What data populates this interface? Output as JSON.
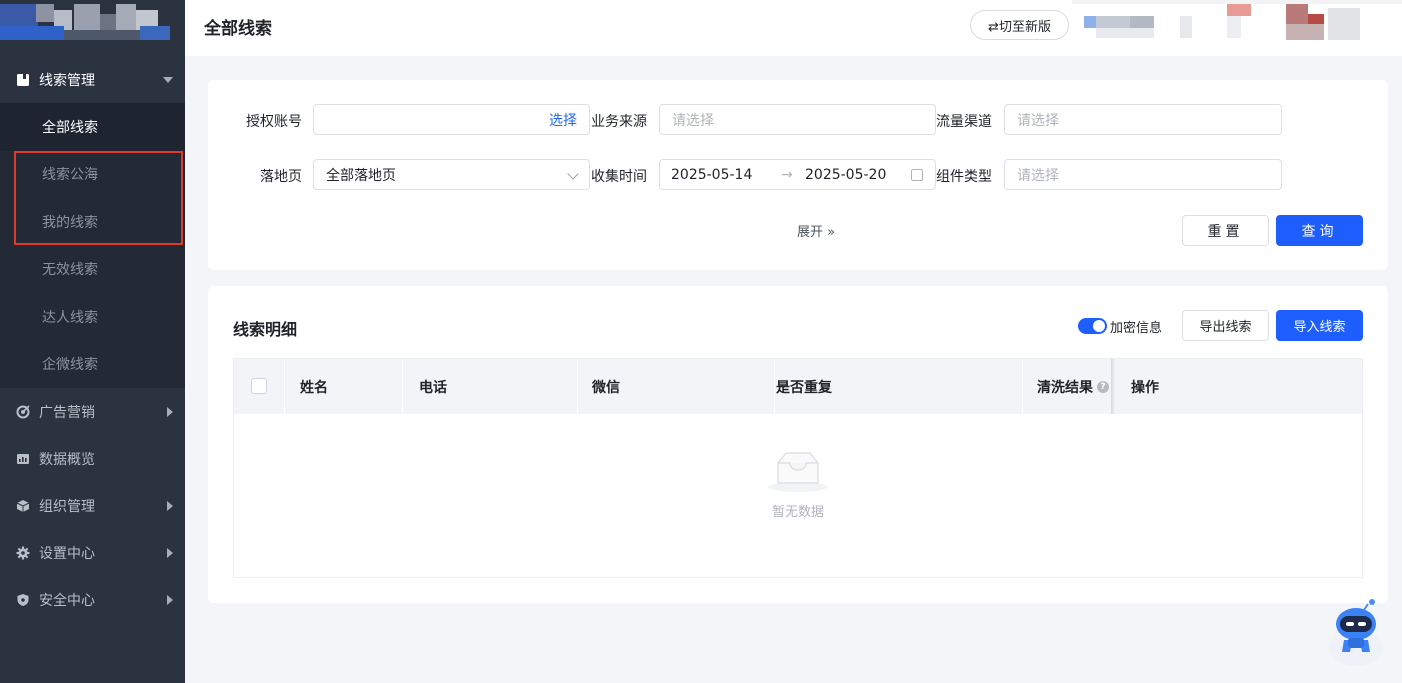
{
  "sidebar": {
    "groups": [
      {
        "label": "线索管理",
        "icon": "document-icon",
        "open": true,
        "items": [
          {
            "label": "全部线索",
            "active": true
          },
          {
            "label": "线索公海"
          },
          {
            "label": "我的线索"
          },
          {
            "label": "无效线索"
          },
          {
            "label": "达人线索"
          },
          {
            "label": "企微线索"
          }
        ]
      },
      {
        "label": "广告营销",
        "icon": "target-icon"
      },
      {
        "label": "数据概览",
        "icon": "chart-icon"
      },
      {
        "label": "组织管理",
        "icon": "cube-icon"
      },
      {
        "label": "设置中心",
        "icon": "gear-icon"
      },
      {
        "label": "安全中心",
        "icon": "shield-icon"
      }
    ]
  },
  "header": {
    "title": "全部线索",
    "switch_label": "⇄切至新版"
  },
  "filters": {
    "account": {
      "label": "授权账号",
      "link": "选择"
    },
    "source": {
      "label": "业务来源",
      "placeholder": "请选择"
    },
    "channel": {
      "label": "流量渠道",
      "placeholder": "请选择"
    },
    "landing": {
      "label": "落地页",
      "value": "全部落地页"
    },
    "collect_time": {
      "label": "收集时间",
      "start": "2025-05-14",
      "sep": "→",
      "end": "2025-05-20"
    },
    "component": {
      "label": "组件类型",
      "placeholder": "请选择"
    },
    "expand_label": "展开 »",
    "reset_label": "重置",
    "query_label": "查询"
  },
  "details": {
    "title": "线索明细",
    "encrypt_label": "加密信息",
    "encrypt_on": true,
    "export_label": "导出线索",
    "import_label": "导入线索",
    "columns": [
      "姓名",
      "电话",
      "微信",
      "是否重复",
      "清洗结果",
      "操作"
    ],
    "empty_text": "暂无数据"
  },
  "colors": {
    "primary": "#1e5eff",
    "sidebar_bg": "#2b3240",
    "highlight": "#e0382b"
  }
}
